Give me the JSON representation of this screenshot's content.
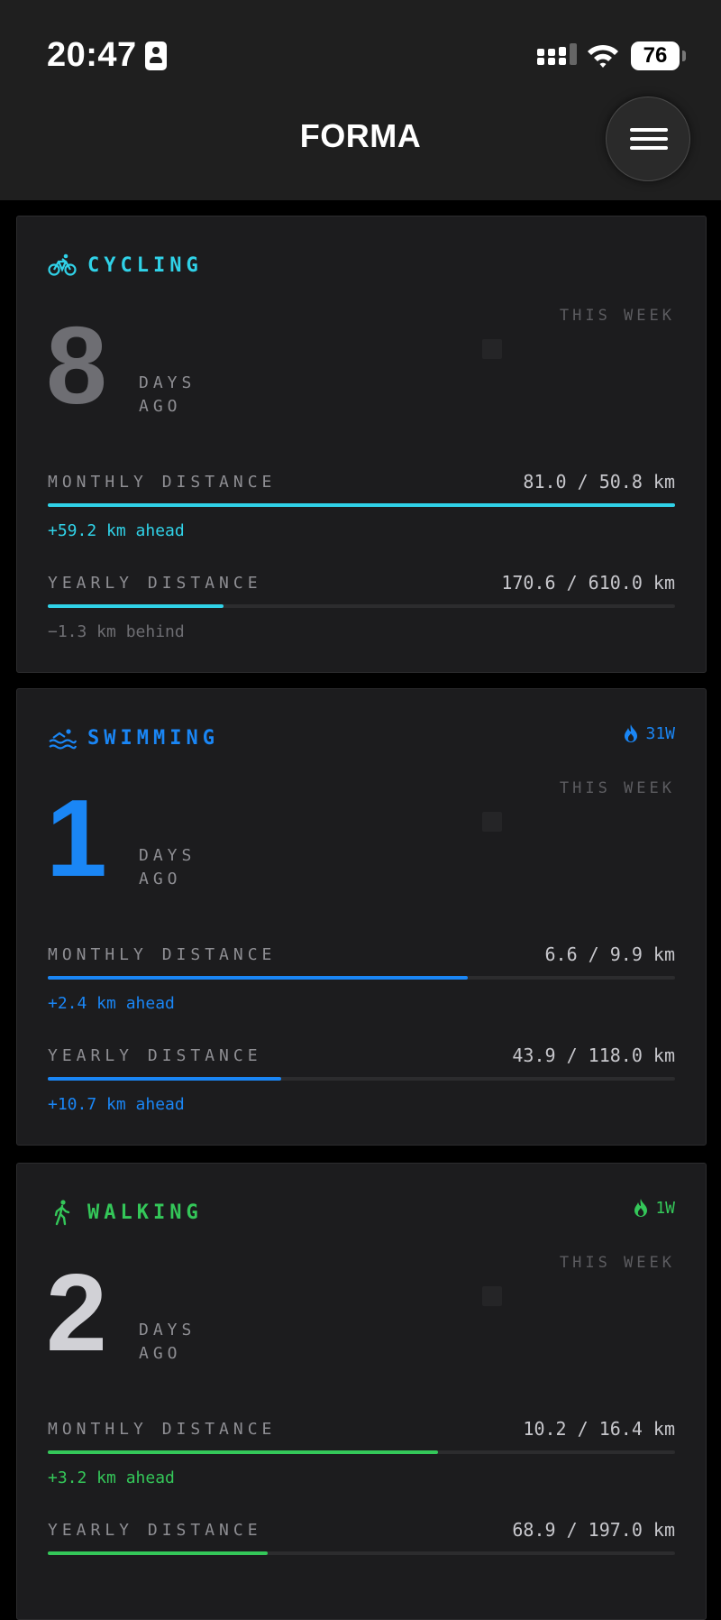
{
  "status_bar": {
    "time": "20:47",
    "battery": "76"
  },
  "header": {
    "title": "FORMA"
  },
  "cards": [
    {
      "sport": "CYCLING",
      "icon": "bicycle-icon",
      "color": "#30d2e8",
      "streak": "",
      "days": "8",
      "days_color": "#6e6e73",
      "days_label_1": "DAYS",
      "days_label_2": "AGO",
      "this_week": "THIS WEEK",
      "monthly": {
        "label": "MONTHLY DISTANCE",
        "value": "81.0 / 50.8 km",
        "progress": 1.0,
        "delta": "+59.2 km ahead",
        "delta_color": "#30d2e8"
      },
      "yearly": {
        "label": "YEARLY DISTANCE",
        "value": "170.6 / 610.0 km",
        "progress": 0.28,
        "delta": "−1.3 km behind",
        "delta_color": "#6e6e73"
      }
    },
    {
      "sport": "SWIMMING",
      "icon": "swimming-icon",
      "color": "#1a86f5",
      "streak": "31W",
      "days": "1",
      "days_color": "#1a86f5",
      "days_label_1": "DAYS",
      "days_label_2": "AGO",
      "this_week": "THIS WEEK",
      "monthly": {
        "label": "MONTHLY DISTANCE",
        "value": "6.6 / 9.9 km",
        "progress": 0.67,
        "delta": "+2.4 km ahead",
        "delta_color": "#1a86f5"
      },
      "yearly": {
        "label": "YEARLY DISTANCE",
        "value": "43.9 / 118.0 km",
        "progress": 0.372,
        "delta": "+10.7 km ahead",
        "delta_color": "#1a86f5"
      }
    },
    {
      "sport": "WALKING",
      "icon": "walking-icon",
      "color": "#34c759",
      "streak": "1W",
      "days": "2",
      "days_color": "#d1d1d6",
      "days_label_1": "DAYS",
      "days_label_2": "AGO",
      "this_week": "THIS WEEK",
      "monthly": {
        "label": "MONTHLY DISTANCE",
        "value": "10.2 / 16.4 km",
        "progress": 0.622,
        "delta": "+3.2 km ahead",
        "delta_color": "#34c759"
      },
      "yearly": {
        "label": "YEARLY DISTANCE",
        "value": "68.9 / 197.0 km",
        "progress": 0.35,
        "delta": "",
        "delta_color": "#34c759"
      }
    }
  ]
}
